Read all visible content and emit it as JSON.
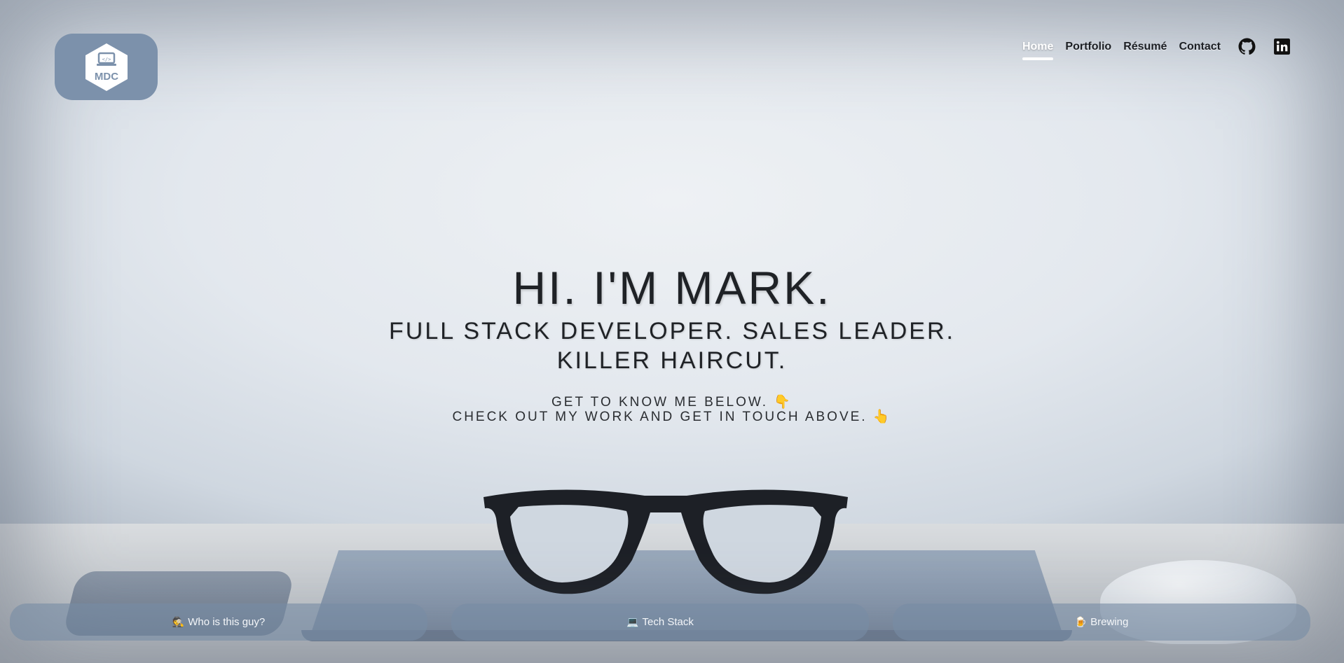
{
  "brand": {
    "logo_text": "MDC"
  },
  "nav": {
    "items": [
      {
        "label": "Home",
        "active": true
      },
      {
        "label": "Portfolio",
        "active": false
      },
      {
        "label": "Résumé",
        "active": false
      },
      {
        "label": "Contact",
        "active": false
      }
    ],
    "icons": [
      "github-icon",
      "linkedin-icon"
    ]
  },
  "hero": {
    "title": "HI. I'M MARK.",
    "subtitle_line1": "FULL STACK DEVELOPER. SALES LEADER.",
    "subtitle_line2": "KILLER HAIRCUT.",
    "cta_line1": "GET TO KNOW ME BELOW. 👇",
    "cta_line2": "CHECK OUT MY WORK AND GET IN TOUCH ABOVE. 👆"
  },
  "tabs": [
    {
      "icon": "spy-icon",
      "glyph": "🕵",
      "label": "Who is this guy?"
    },
    {
      "icon": "laptop-icon",
      "glyph": "💻",
      "label": "Tech Stack"
    },
    {
      "icon": "beer-icon",
      "glyph": "🍺",
      "label": "Brewing"
    }
  ],
  "colors": {
    "logo_bg": "#7c91ab",
    "tab_bg": "#788ca5",
    "text_dark": "#1f2226",
    "active_nav": "#ffffff"
  }
}
